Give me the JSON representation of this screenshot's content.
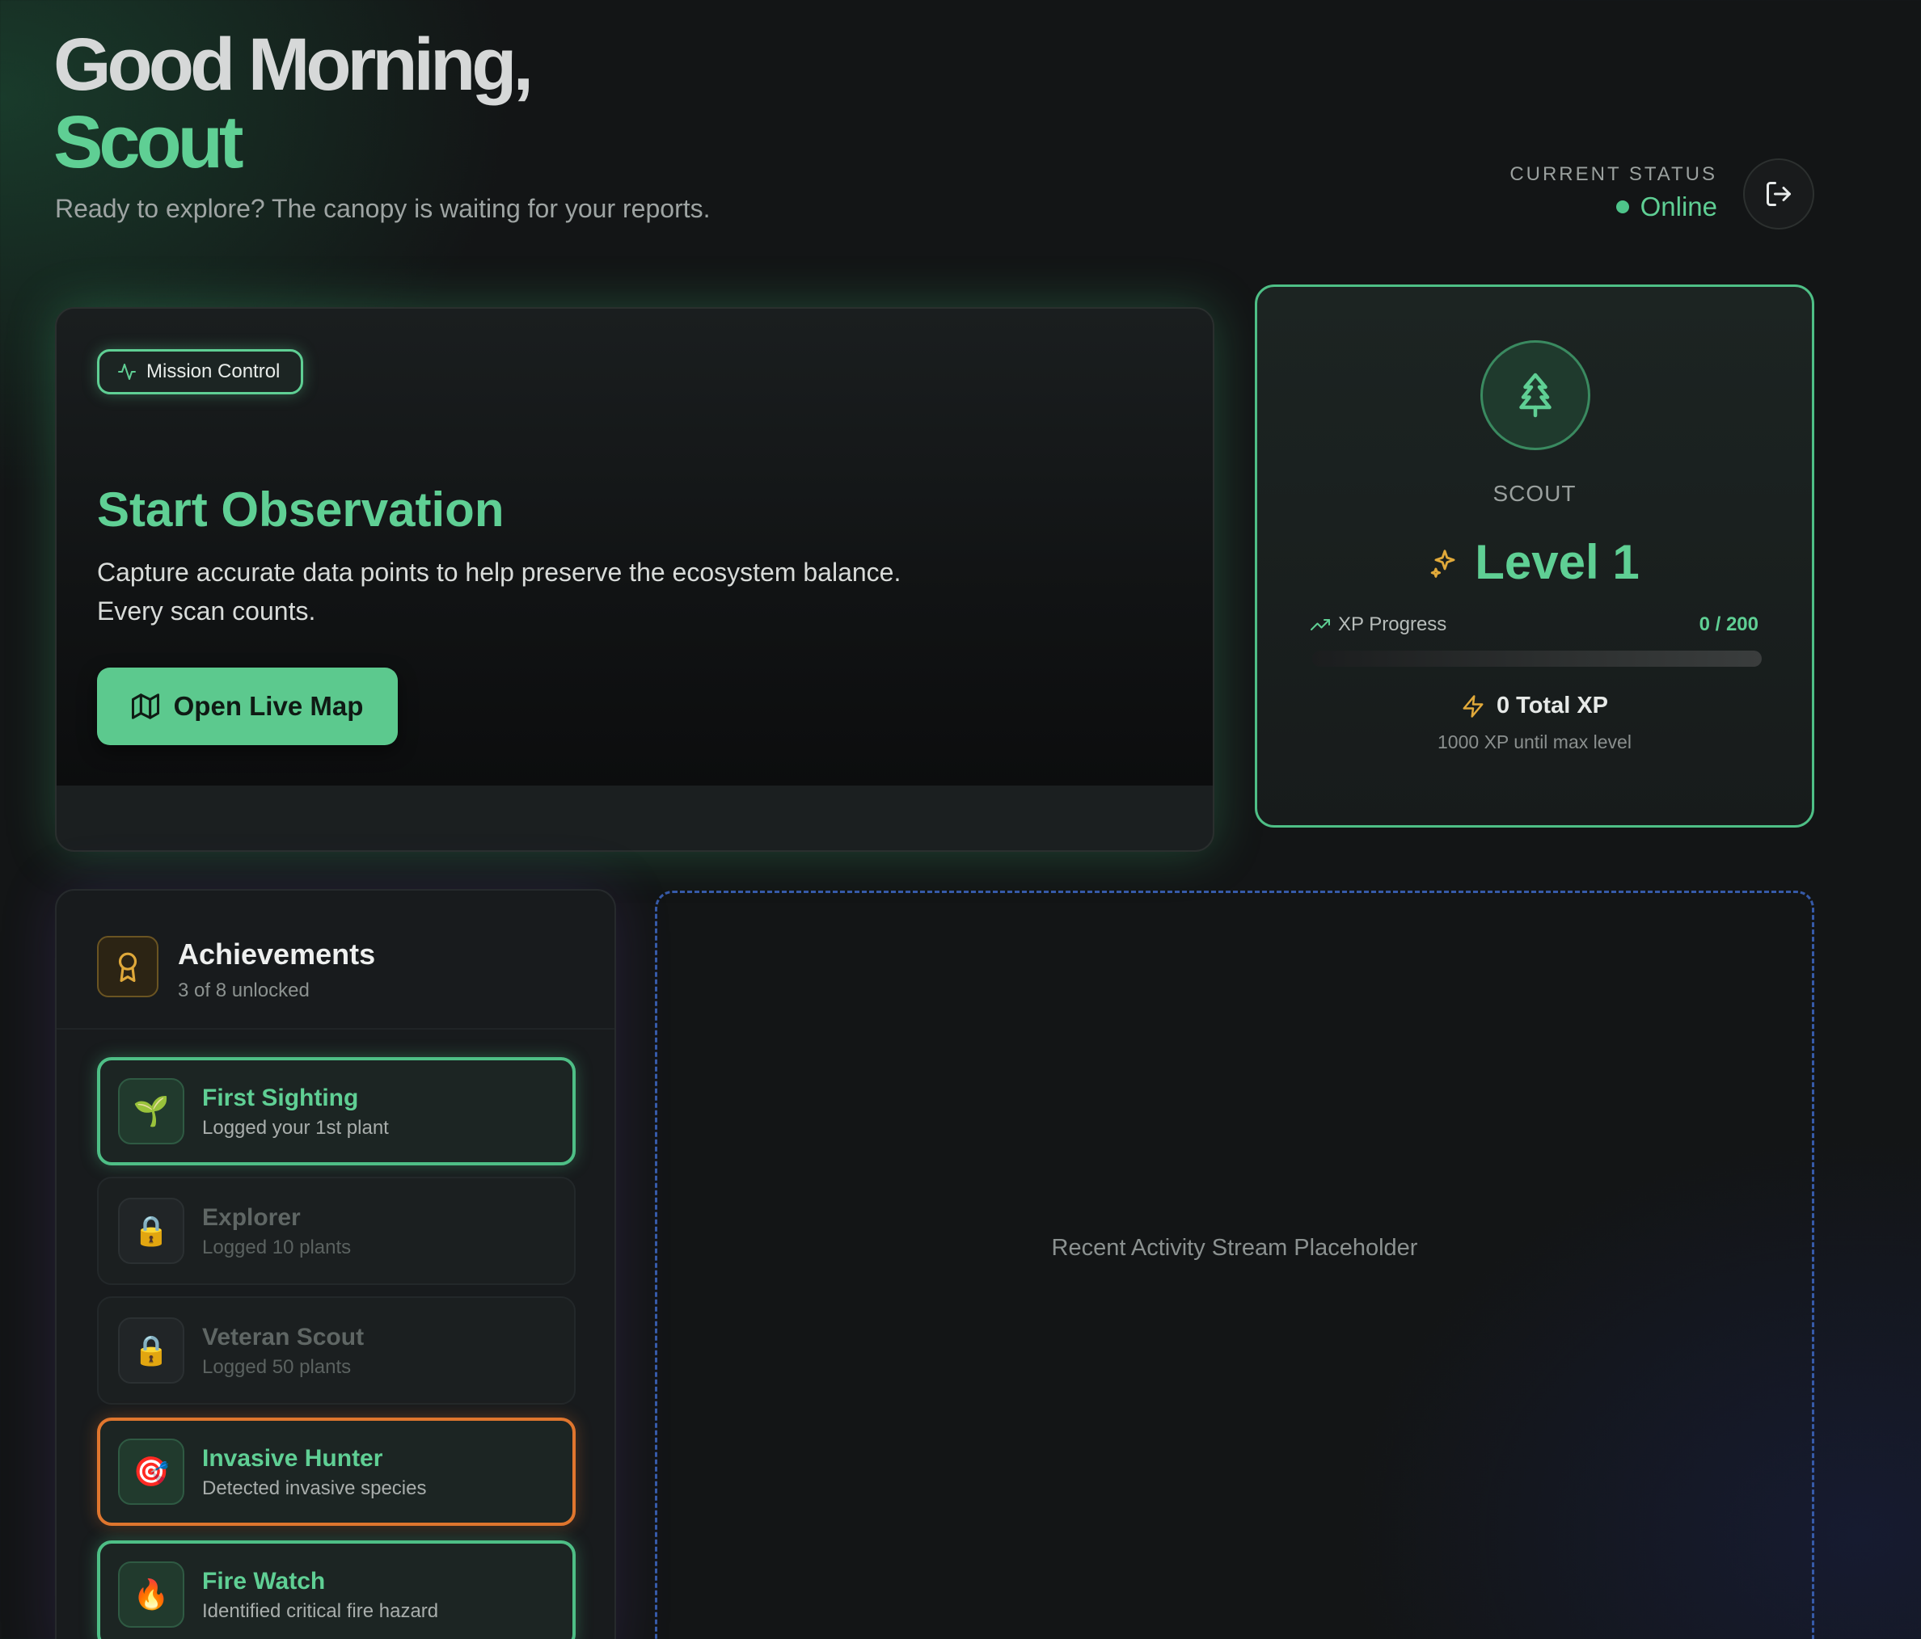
{
  "header": {
    "greeting_line1": "Good Morning,",
    "greeting_line2": "Scout",
    "subtitle": "Ready to explore? The canopy is waiting for your reports.",
    "status_label": "CURRENT STATUS",
    "status_value": "Online",
    "logout_icon": "logout-icon"
  },
  "mission": {
    "badge": "Mission Control",
    "badge_icon": "activity-icon",
    "title": "Start Observation",
    "description_line1": "Capture accurate data points to help preserve the ecosystem balance.",
    "description_line2": "Every scan counts.",
    "button_label": "Open Live Map",
    "button_icon": "map-icon"
  },
  "profile": {
    "avatar_icon": "tree-icon",
    "role": "SCOUT",
    "level_label": "Level 1",
    "xp_label": "XP Progress",
    "xp_current": 0,
    "xp_max": 200,
    "xp_count_text": "0 / 200",
    "total_xp": "0 Total XP",
    "until_max": "1000 XP until max level"
  },
  "achievements": {
    "title": "Achievements",
    "summary": "3 of 8 unlocked",
    "items": [
      {
        "name": "First Sighting",
        "desc": "Logged your 1st plant",
        "unlocked": true,
        "icon": "🌱"
      },
      {
        "name": "Explorer",
        "desc": "Logged 10 plants",
        "unlocked": false,
        "icon": "🔒"
      },
      {
        "name": "Veteran Scout",
        "desc": "Logged 50 plants",
        "unlocked": false,
        "icon": "🔒"
      },
      {
        "name": "Invasive Hunter",
        "desc": "Detected invasive species",
        "unlocked": true,
        "icon": "🎯"
      },
      {
        "name": "Fire Watch",
        "desc": "Identified critical fire hazard",
        "unlocked": true,
        "icon": "🔥"
      }
    ]
  },
  "activity": {
    "placeholder": "Recent Activity Stream Placeholder"
  },
  "colors": {
    "accent": "#5fcf94",
    "background": "#131516",
    "warning_border": "#e0762e",
    "placeholder_border": "#365aa8",
    "gold": "#e0a93a"
  }
}
